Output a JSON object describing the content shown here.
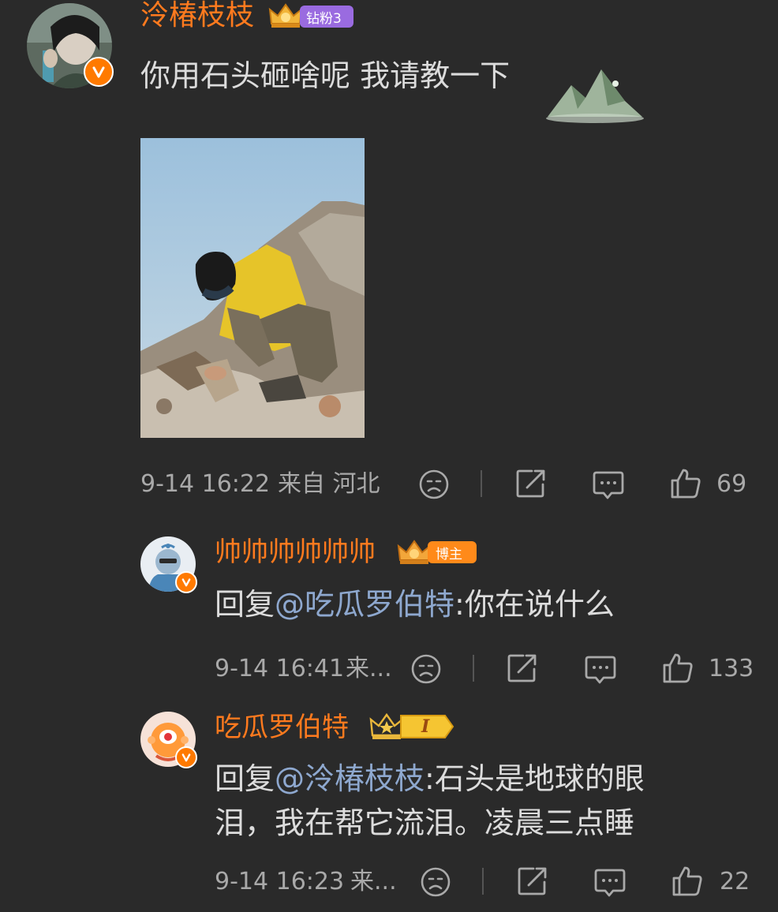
{
  "comments": [
    {
      "username": "泠椿枝枝",
      "badge": "钻粉3",
      "text": "你用石头砸啥呢 我请教一下",
      "time": "9-14 16:22",
      "location": "来自 河北",
      "likes": "69"
    },
    {
      "username": "帅帅帅帅帅帅",
      "badge": "博主",
      "reply_prefix": "回复",
      "mention": "@吃瓜罗伯特",
      "text": ":你在说什么",
      "time": "9-14 16:41",
      "location": "来...",
      "likes": "133"
    },
    {
      "username": "吃瓜罗伯特",
      "badge": "I",
      "reply_prefix": "回复",
      "mention": "@泠椿枝枝",
      "text_line1": ":石头是地球的眼",
      "text_line2": "泪，我在帮它流泪。凌晨三点睡",
      "time": "9-14 16:23",
      "location": "来...",
      "likes": "22"
    }
  ],
  "colors": {
    "background": "#2a2a2a",
    "username": "#ff7a1e",
    "mention": "#8ea8cf",
    "meta": "#a9a9a9",
    "verified": "#ff7a00"
  },
  "icons": [
    "emoji-icon",
    "share-icon",
    "comment-icon",
    "like-icon",
    "verified-icon",
    "mountain-sticker"
  ]
}
